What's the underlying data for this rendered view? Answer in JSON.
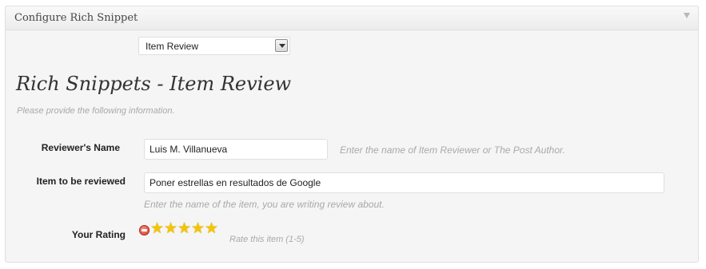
{
  "panel": {
    "title": "Configure Rich Snippet"
  },
  "type_select": {
    "selected": "Item Review"
  },
  "section": {
    "title": "Rich Snippets - Item Review",
    "subtitle": "Please provide the following information."
  },
  "fields": {
    "reviewer": {
      "label": "Reviewer's Name",
      "value": "Luis M. Villanueva",
      "hint": "Enter the name of Item Reviewer or The Post Author."
    },
    "item": {
      "label": "Item to be reviewed",
      "value": "Poner estrellas en resultados de Google",
      "hint": "Enter the name of the item, you are writing review about."
    },
    "rating": {
      "label": "Your Rating",
      "value": 5,
      "max": 5,
      "hint": "Rate this item (1-5)"
    }
  },
  "colors": {
    "star": "#f5c400",
    "cancel": "#d23b2a"
  },
  "icons": {
    "cancel": "cancel-rating-icon",
    "star": "star-icon",
    "toggle": "chevron-down-icon"
  }
}
